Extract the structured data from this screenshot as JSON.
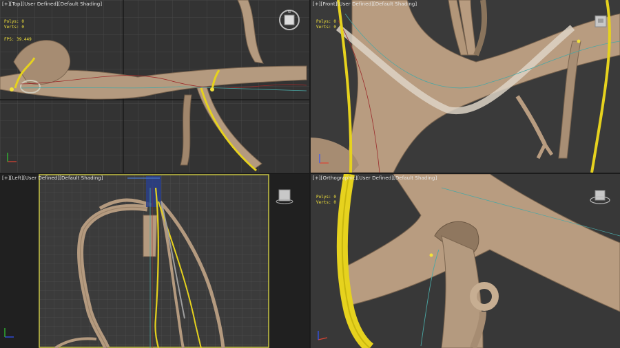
{
  "viewports": {
    "top": {
      "plus": "[+]",
      "view": "[Top]",
      "mode": "[User Defined]",
      "shading": "[Default Shading]"
    },
    "front": {
      "plus": "[+]",
      "view": "[Front]",
      "mode": "[User Defined]",
      "shading": "[Default Shading]"
    },
    "left": {
      "plus": "[+]",
      "view": "[Left]",
      "mode": "[User Defined]",
      "shading": "[Default Shading]"
    },
    "ortho": {
      "plus": "[+]",
      "view": "[Orthographic]",
      "mode": "[User Defined]",
      "shading": "[Default Shading]"
    }
  },
  "stats": {
    "top": {
      "polys_label": "Polys:",
      "polys_value": "0",
      "verts_label": "Verts:",
      "verts_value": "0",
      "fps_label": "FPS:",
      "fps_value": "39.449"
    },
    "front": {
      "polys_label": "Polys:",
      "polys_value": "0",
      "verts_label": "Verts:",
      "verts_value": "0"
    },
    "ortho": {
      "polys_label": "Polys:",
      "polys_value": "0",
      "verts_label": "Verts:",
      "verts_value": "0"
    }
  },
  "icons": {
    "viewcube": "viewcube-icon",
    "axis_gizmo": "axis-gizmo-icon"
  },
  "colors": {
    "viewport_bg": "#333333",
    "vessel": "#b49a7f",
    "nerve": "#e6d21e",
    "active_border": "#c9c645",
    "spline_red": "#9b2b2b",
    "spline_cyan": "#4aa7a4"
  }
}
